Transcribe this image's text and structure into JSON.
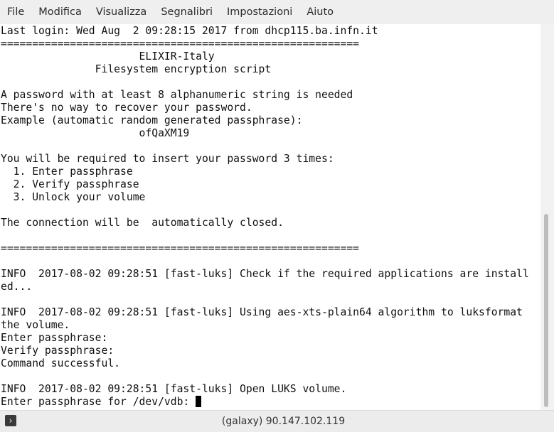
{
  "menu": {
    "items": [
      "File",
      "Modifica",
      "Visualizza",
      "Segnalibri",
      "Impostazioni",
      "Aiuto"
    ]
  },
  "terminal": {
    "lines": [
      "Last login: Wed Aug  2 09:28:15 2017 from dhcp115.ba.infn.it",
      "=========================================================",
      "                      ELIXIR-Italy",
      "               Filesystem encryption script",
      "",
      "A password with at least 8 alphanumeric string is needed",
      "There's no way to recover your password.",
      "Example (automatic random generated passphrase):",
      "                      ofQaXM19",
      "",
      "You will be required to insert your password 3 times:",
      "  1. Enter passphrase",
      "  2. Verify passphrase",
      "  3. Unlock your volume",
      "",
      "The connection will be  automatically closed.",
      "",
      "=========================================================",
      "",
      "INFO  2017-08-02 09:28:51 [fast-luks] Check if the required applications are install",
      "ed...",
      "",
      "INFO  2017-08-02 09:28:51 [fast-luks] Using aes-xts-plain64 algorithm to luksformat",
      "the volume.",
      "Enter passphrase:",
      "Verify passphrase:",
      "Command successful.",
      "",
      "INFO  2017-08-02 09:28:51 [fast-luks] Open LUKS volume."
    ],
    "prompt": "Enter passphrase for /dev/vdb: "
  },
  "statusbar": {
    "icon": "terminal-icon",
    "title": "(galaxy) 90.147.102.119"
  }
}
